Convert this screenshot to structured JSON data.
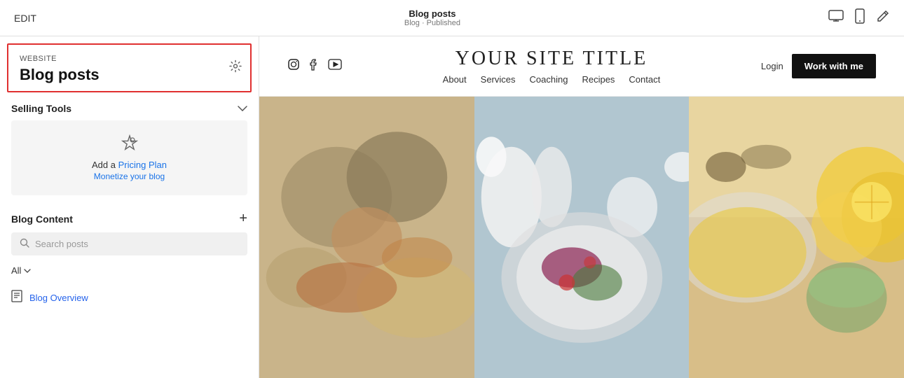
{
  "topbar": {
    "edit_label": "EDIT",
    "page_title": "Blog posts",
    "page_subtitle": "Blog · Published",
    "icons": {
      "desktop": "🖥",
      "mobile": "📱",
      "paint": "✏️"
    }
  },
  "sidebar": {
    "website_label": "WEBSITE",
    "page_name": "Blog posts",
    "selling_tools": {
      "title": "Selling Tools",
      "collapsed": false,
      "pricing_plan": {
        "icon": "🏷",
        "line1_prefix": "Add a ",
        "line1_highlight": "Pricing Plan",
        "line2": "Monetize your blog"
      }
    },
    "blog_content": {
      "title": "Blog Content",
      "search_placeholder": "Search posts",
      "filter_label": "All",
      "overview_label": "Blog Overview"
    }
  },
  "preview": {
    "site_title": "YOUR SITE TITLE",
    "social_icons": [
      "instagram",
      "facebook",
      "youtube"
    ],
    "nav_items": [
      "About",
      "Services",
      "Coaching",
      "Recipes",
      "Contact"
    ],
    "login_label": "Login",
    "cta_label": "Work with me"
  }
}
